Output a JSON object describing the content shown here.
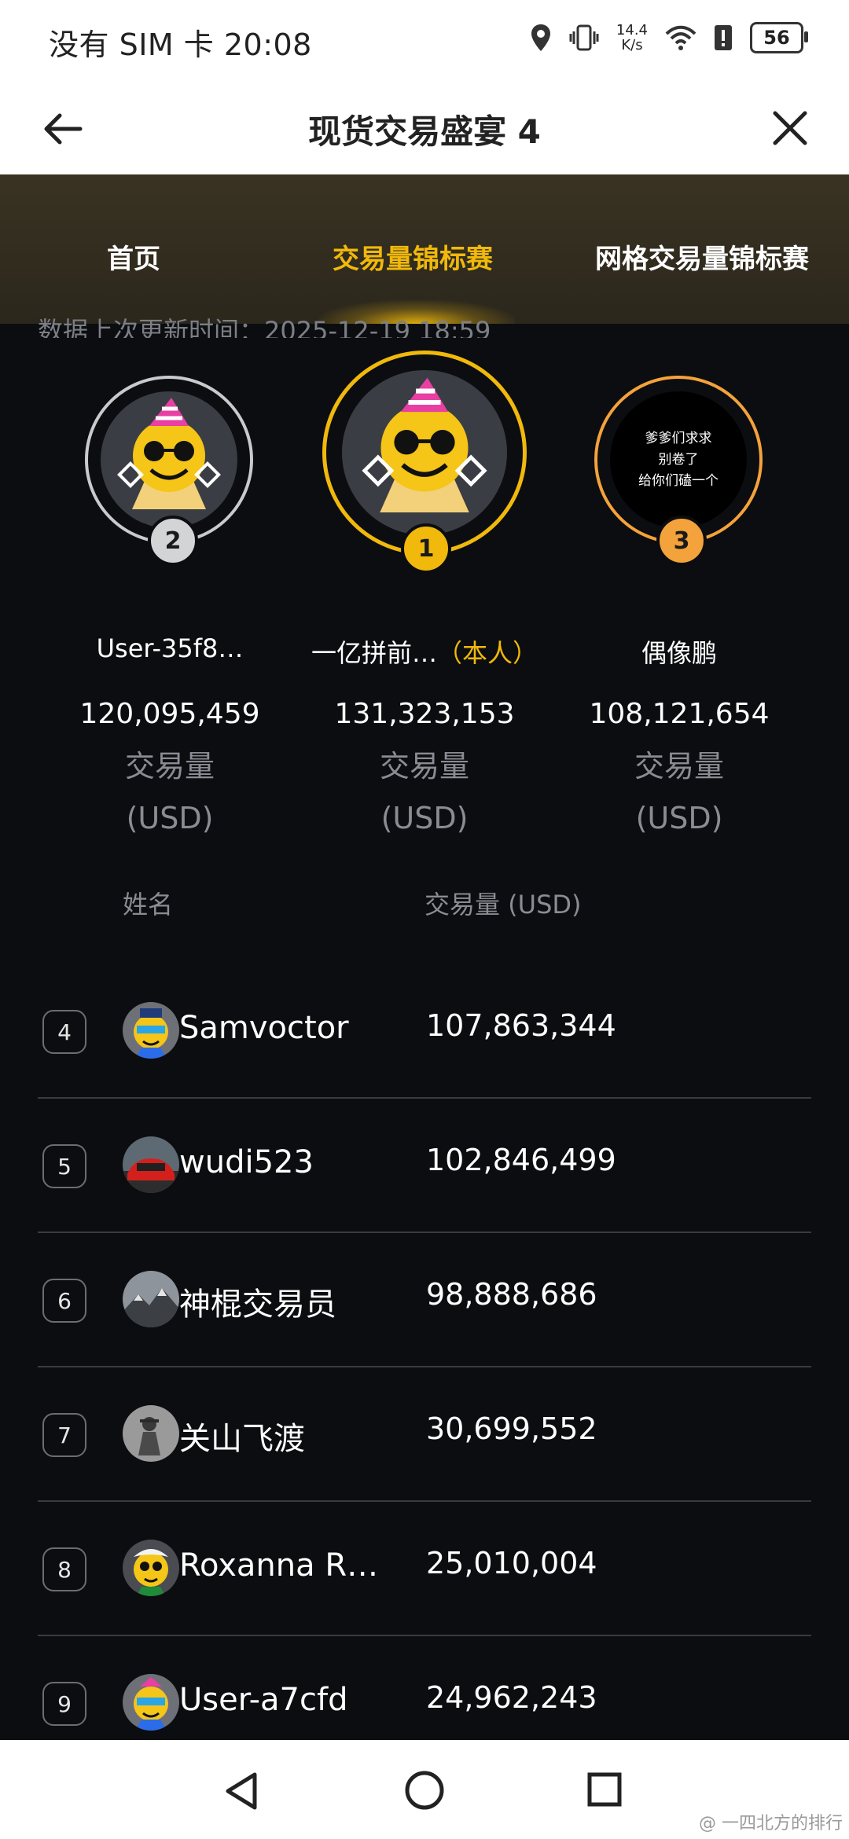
{
  "status_bar": {
    "carrier_time": "没有 SIM 卡 20:08",
    "net_speed_value": "14.4",
    "net_speed_unit": "K/s",
    "battery": "56",
    "icons": [
      "location-icon",
      "vibrate-icon",
      "wifi-icon",
      "alert-icon",
      "battery-icon"
    ]
  },
  "nav": {
    "title": "现货交易盛宴 4"
  },
  "tabs": [
    {
      "label": "首页"
    },
    {
      "label": "交易量锦标赛"
    },
    {
      "label": "网格交易量锦标赛"
    }
  ],
  "updated_text": "数据上次更新时间：2025-12-19 18:59",
  "podium": {
    "first": {
      "rank": "1",
      "name": "一亿拼前…",
      "self_tag": "（本人）",
      "value": "131,323,153",
      "label_volume": "交易量",
      "label_unit": "(USD)"
    },
    "second": {
      "rank": "2",
      "name": "User-35f8…",
      "value": "120,095,459",
      "label_volume": "交易量",
      "label_unit": "(USD)"
    },
    "third": {
      "rank": "3",
      "name": "偶像鹏",
      "value": "108,121,654",
      "label_volume": "交易量",
      "label_unit": "(USD)",
      "avatar_text_1": "爹爹们求求",
      "avatar_text_2": "别卷了",
      "avatar_text_3": "给你们磕一个"
    }
  },
  "list_header": {
    "name": "姓名",
    "volume": "交易量 (USD)"
  },
  "rows": [
    {
      "rank": "4",
      "name": "Samvoctor",
      "value": "107,863,344"
    },
    {
      "rank": "5",
      "name": "wudi523",
      "value": "102,846,499"
    },
    {
      "rank": "6",
      "name": "神棍交易员",
      "value": "98,888,686"
    },
    {
      "rank": "7",
      "name": "关山飞渡",
      "value": "30,699,552"
    },
    {
      "rank": "8",
      "name": "Roxanna R…",
      "value": "25,010,004"
    },
    {
      "rank": "9",
      "name": "User-a7cfd",
      "value": "24,962,243"
    }
  ],
  "watermark": "@ 一四北方的排行"
}
